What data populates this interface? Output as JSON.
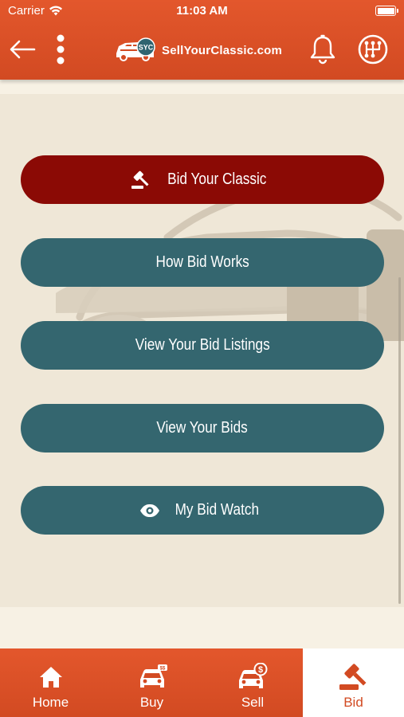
{
  "status": {
    "carrier": "Carrier",
    "time": "11:03 AM"
  },
  "header": {
    "logo_badge": "SYC",
    "logo_text": "SellYourClassic.com"
  },
  "buttons": [
    {
      "label": "Bid Your Classic",
      "icon": "gavel-icon",
      "style": "primary"
    },
    {
      "label": "How Bid Works",
      "style": "secondary"
    },
    {
      "label": "View Your Bid Listings",
      "style": "secondary"
    },
    {
      "label": "View Your Bids",
      "style": "secondary"
    },
    {
      "label": "My Bid Watch",
      "icon": "eye-icon",
      "style": "secondary"
    }
  ],
  "tabs": [
    {
      "label": "Home",
      "icon": "home-icon",
      "active": false
    },
    {
      "label": "Buy",
      "icon": "car-icon",
      "active": false
    },
    {
      "label": "Sell",
      "icon": "car-dollar-icon",
      "active": false
    },
    {
      "label": "Bid",
      "icon": "gavel-icon",
      "active": true
    }
  ],
  "colors": {
    "brand_orange": "#d24a22",
    "primary_button": "#8b0a05",
    "secondary_button": "#34666f",
    "content_bg": "#efe7d7"
  }
}
